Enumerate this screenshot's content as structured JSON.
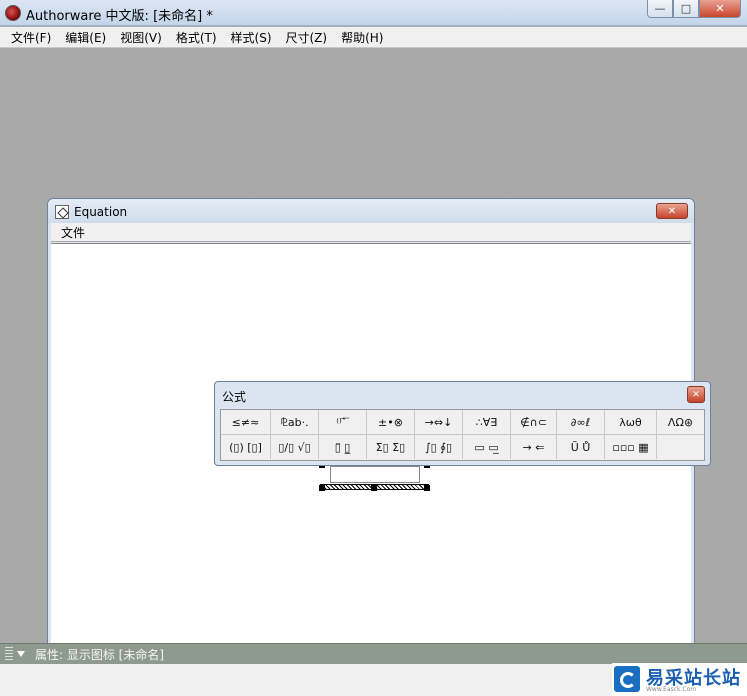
{
  "app": {
    "title": "Authorware 中文版: [未命名] *",
    "window_buttons": {
      "minimize": "—",
      "maximize": "□",
      "close": "✕"
    }
  },
  "menubar": {
    "items": [
      "文件(F)",
      "编辑(E)",
      "视图(V)",
      "格式(T)",
      "样式(S)",
      "尺寸(Z)",
      "帮助(H)"
    ]
  },
  "equation_window": {
    "title": "Equation",
    "close": "✕",
    "menu": [
      "文件"
    ]
  },
  "palette": {
    "title": "公式",
    "close": "✕",
    "row1": [
      "≤≠≈",
      "⅊ab·.",
      "⁽⁾ ⃗ ⃛",
      "±•⊗",
      "→⇔↓",
      "∴∀∃",
      "∉∩⊂",
      "∂∞ℓ",
      "λωθ",
      "ΛΩ⊛"
    ],
    "row2": [
      "(▯) [▯]",
      "▯/▯ √▯",
      "▯̈ ▯̲",
      "Σ▯ Σ▯",
      "∫▯ ∮▯",
      "▭ ▭̲",
      "→ ⇐",
      "Ũ Ů",
      "▫▫▫ ▦"
    ]
  },
  "properties": {
    "label": "属性: 显示图标 [未命名]"
  },
  "watermark": {
    "text": "易采站长站",
    "sub": "Www.Easck.Com"
  },
  "colors": {
    "desktop": "#a9a9a9",
    "close_red": "#c7452c",
    "props_bar": "#8e9a8e"
  }
}
